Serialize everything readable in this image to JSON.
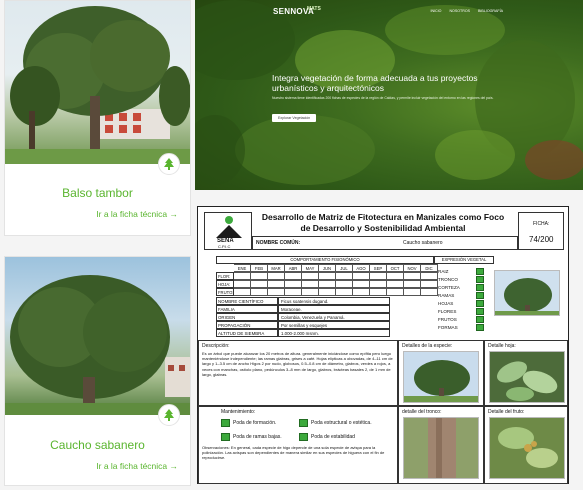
{
  "cards": [
    {
      "title": "Balso tambor",
      "link": "Ir a la ficha técnica →"
    },
    {
      "title": "Caucho sabanero",
      "link": "Ir a la ficha técnica →"
    }
  ],
  "hero": {
    "logo": "SENNOVA",
    "logo_small": "MATS",
    "nav": [
      "INICIO",
      "NOSOTROS",
      "BIBLIOGRAFÍA"
    ],
    "headline": "Integra vegetación de forma adecuada a tus proyectos urbanísticos y arquitectónicos",
    "subtext": "Nuestro sistema tiene identificadas 200 fichas de especies de la región de Caldas, y permite incluir vegetación del entorno en las regiones del país.",
    "button": "Explorar Vegetación",
    "accent": "#5ab52f"
  },
  "sheet": {
    "title": "Desarrollo de Matriz de Fitotectura en Manizales como Foco de Desarrollo y Sostenibilidad Ambiental",
    "sena": "SENA",
    "cpic": "C.P.I.C",
    "ficha_label": "FICHA:",
    "ficha_value": "74/200",
    "nombre_label": "NOMBRE COMÚN:",
    "nombre_value": "Caucho sabanero",
    "comport_label": "COMPORTAMIENTO FISIONÓMICO",
    "months": [
      "ENE",
      "FEB",
      "MAR",
      "ABR",
      "MAY",
      "JUN",
      "JUL",
      "AGO",
      "SEP",
      "OCT",
      "NOV",
      "DIC"
    ],
    "rows": [
      "FLOR:",
      "HOJA:",
      "FRUTO:"
    ],
    "expresion_label": "EXPRESIÓN VEGETAL",
    "expresion_items": [
      "RAIZ",
      "TRONCO",
      "CORTEZA",
      "RAMAS",
      "HOJAS",
      "FLORES",
      "FRUTOS",
      "FORMAS"
    ],
    "props": [
      {
        "k": "NOMBRE CIENTÍFICO",
        "v": "Ficus soatensis dugand."
      },
      {
        "k": "FAMILIA",
        "v": "Moraceae."
      },
      {
        "k": "ORIGEN",
        "v": "Colombia, Venezuela y Panamá."
      },
      {
        "k": "PROPAGACIÓN",
        "v": "Por semillas y esquejes"
      },
      {
        "k": "ALTITUD DE SIEMBRA",
        "v": "1.000-2.000 msnm."
      }
    ],
    "desc_label": "Descripción:",
    "desc_text": "Es un árbol que puede alcanzar los 20 metros de altura. generalmente iniciándose como epífita pero luego manteniéndose independiente; las ramas glabras, grises a café. Hojas elípticas a obovadas, de 4–11 cm de largo y 1–3.5 cm de ancho Higos 2 por nudo, globosos, 0.5–0.8 cm de diámetro, glabros, verdes a rojos, a veces con manchas, ostíolo plano, pedúnculos 3–8 mm de largo, glabros, brácteas basales 2, de 1 mm de largo, glabras.",
    "detail_especie": "Detalles de la especie:",
    "detail_hoja": "Detalle hoja:",
    "detail_tronco": "detalle del tronco:",
    "detail_fruto": "Detalle del fruto:",
    "mant_label": "Mantenimiento:",
    "mant": [
      "Poda de formación.",
      "Poda estructural o estética.",
      "Poda de ramas bajas.",
      "Poda de estabilidad"
    ],
    "obs": "Observaciones: En general, cada especie de higo depende de una sola especie de avispa para la polinización. Las avispas son dependientes de manera similar en sus especies de higuera con el fin de reproducirse."
  }
}
